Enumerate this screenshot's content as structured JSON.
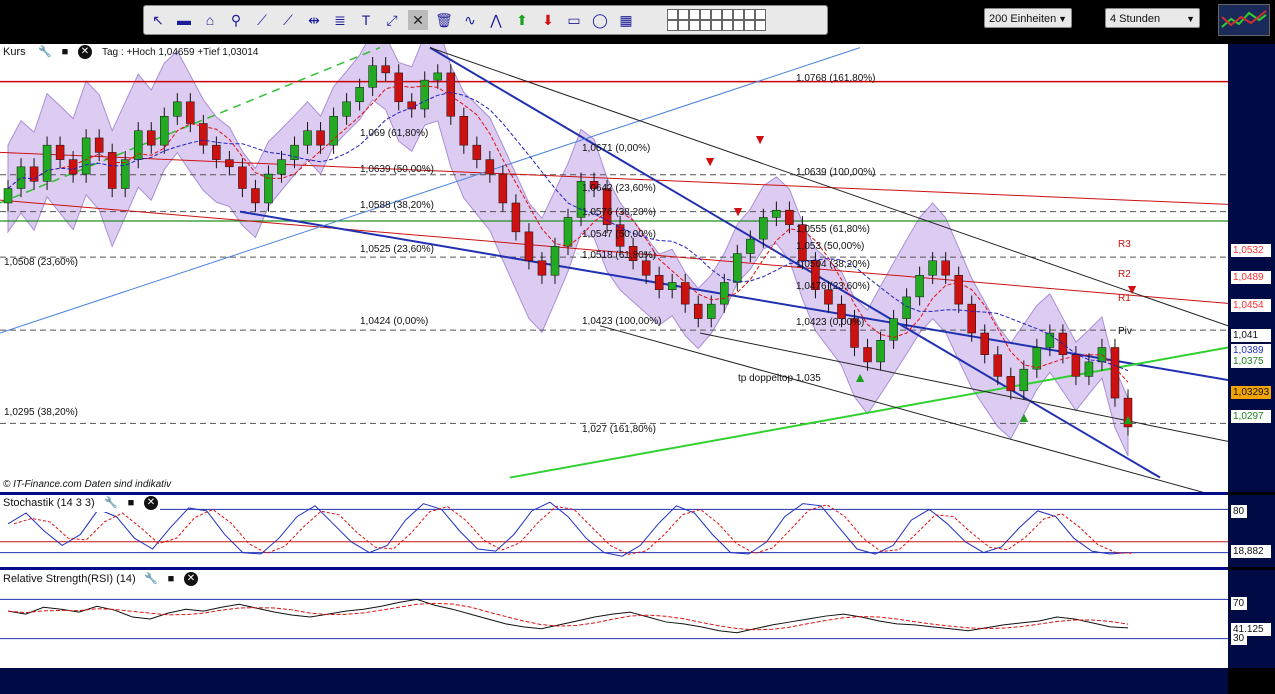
{
  "toolbar": {
    "tools": [
      "pointer-icon",
      "ruler-icon",
      "magnet-icon",
      "zoom-icon",
      "line-icon",
      "ray-icon",
      "horizontal-line-icon",
      "fibonacci-icon",
      "text-icon",
      "arrows-icon",
      "tools-icon",
      "trash-icon",
      "wave-icon",
      "fib-fan-icon",
      "arrow-up-icon",
      "arrow-down-icon",
      "rectangle-icon",
      "ellipse-icon",
      "pattern-icon"
    ],
    "swatch_colors": [
      "#ffffff",
      "#ffffff",
      "#ffffff",
      "#ffffff",
      "#ffffff",
      "#ffffff",
      "#ffffff",
      "#ffffff",
      "#ffffff",
      "#ffffff",
      "#ffffff",
      "#ffffff",
      "#ffffff",
      "#ffffff",
      "#ffffff",
      "#ffffff",
      "#ffffff",
      "#ffffff"
    ],
    "units_select": "200 Einheiten",
    "interval_select": "4 Stunden"
  },
  "main": {
    "title": "Kurs",
    "info": "Tag : +Hoch 1,04659 +Tief 1,03014",
    "footer": "© IT-Finance.com  Daten sind indikativ",
    "annotations": [
      {
        "id": "fib1",
        "text": "1,0768 (161,80%)"
      },
      {
        "id": "fib2",
        "text": "1,069 (61,80%)"
      },
      {
        "id": "fib3",
        "text": "1,0671 (0,00%)"
      },
      {
        "id": "fib4",
        "text": "1,0639 (50,00%)"
      },
      {
        "id": "fib5",
        "text": "1,0639 (100,00%)"
      },
      {
        "id": "fib6",
        "text": "1,0642 (23,60%)"
      },
      {
        "id": "fib7",
        "text": "1,0588 (38,20%)"
      },
      {
        "id": "fib8",
        "text": "1,0576 (38,20%)"
      },
      {
        "id": "fib9",
        "text": "1,0555 (61,80%)"
      },
      {
        "id": "fib10",
        "text": "1,0547 (50,00%)"
      },
      {
        "id": "fib11",
        "text": "1,053 (50,00%)"
      },
      {
        "id": "fib12",
        "text": "1,0525 (23,60%)"
      },
      {
        "id": "fib13",
        "text": "1,0518 (61,80%)"
      },
      {
        "id": "fib14",
        "text": "1,0508 (23,60%)"
      },
      {
        "id": "fib15",
        "text": "1,0504 (38,20%)"
      },
      {
        "id": "fib16",
        "text": "1,0476 (23,60%)"
      },
      {
        "id": "fib17",
        "text": "1,0424 (0,00%)"
      },
      {
        "id": "fib18",
        "text": "1,0423 (100,00%)"
      },
      {
        "id": "fib19",
        "text": "1,0423 (0,00%)"
      },
      {
        "id": "fib20",
        "text": "tp doppeltop 1,035"
      },
      {
        "id": "fib21",
        "text": "1,0295 (38,20%)"
      },
      {
        "id": "fib22",
        "text": "1,027 (161,80%)"
      },
      {
        "id": "r3",
        "text": "R3"
      },
      {
        "id": "r2",
        "text": "R2"
      },
      {
        "id": "r1",
        "text": "R1"
      },
      {
        "id": "piv",
        "text": "Piv"
      }
    ],
    "price_labels": [
      {
        "text": "1,0532",
        "color": "#ff3030",
        "bg": "#ffffff"
      },
      {
        "text": "1,0489",
        "color": "#ff3030",
        "bg": "#ffffff"
      },
      {
        "text": "1,0454",
        "color": "#ff3030",
        "bg": "#ffffff"
      },
      {
        "text": "1,041",
        "color": "#111111",
        "bg": "#ffffff"
      },
      {
        "text": "1,0389",
        "color": "#2030c0",
        "bg": "#ffffff"
      },
      {
        "text": "1,0375",
        "color": "#208020",
        "bg": "#ffffff"
      },
      {
        "text": "1,03293",
        "color": "#111111",
        "bg": "#f2a400"
      },
      {
        "text": "1,0297",
        "color": "#208020",
        "bg": "#ffffff"
      }
    ]
  },
  "stochastic": {
    "title": "Stochastik (14 3 3)",
    "level_high": "80",
    "value": "18,882"
  },
  "rsi": {
    "title": "Relative Strength(RSI) (14)",
    "level_high": "70",
    "level_low": "30",
    "value": "41,125"
  },
  "colors": {
    "background": "#000000",
    "axis_bg": "#000a44",
    "bollinger_fill": "#d8c4f0",
    "candle_up": "#22aa22",
    "candle_down": "#cc1111",
    "panel_border": "#000a8a"
  },
  "chart_data": {
    "type": "candlestick",
    "title": "",
    "last_price": 1.03293,
    "day_high": 1.04659,
    "day_low": 1.03014,
    "ylim": [
      1.02,
      1.082
    ],
    "horizontal_levels": [
      1.0768,
      1.0588,
      1.0639,
      1.0525,
      1.0424,
      1.0295
    ],
    "pivots": {
      "R3": 1.0532,
      "R2": 1.0489,
      "R1": 1.0454,
      "Piv": 1.041
    },
    "closes": [
      1.062,
      1.065,
      1.063,
      1.068,
      1.066,
      1.064,
      1.069,
      1.067,
      1.062,
      1.066,
      1.07,
      1.068,
      1.072,
      1.074,
      1.071,
      1.068,
      1.066,
      1.065,
      1.062,
      1.06,
      1.064,
      1.066,
      1.068,
      1.07,
      1.068,
      1.072,
      1.074,
      1.076,
      1.079,
      1.078,
      1.074,
      1.073,
      1.077,
      1.078,
      1.072,
      1.068,
      1.066,
      1.064,
      1.06,
      1.056,
      1.052,
      1.05,
      1.054,
      1.058,
      1.063,
      1.062,
      1.057,
      1.054,
      1.052,
      1.05,
      1.048,
      1.049,
      1.046,
      1.044,
      1.046,
      1.049,
      1.053,
      1.055,
      1.058,
      1.059,
      1.057,
      1.052,
      1.048,
      1.046,
      1.044,
      1.04,
      1.038,
      1.041,
      1.044,
      1.047,
      1.05,
      1.052,
      1.05,
      1.046,
      1.042,
      1.039,
      1.036,
      1.034,
      1.037,
      1.04,
      1.042,
      1.039,
      1.036,
      1.038,
      1.04,
      1.033,
      1.029
    ],
    "stochastic": [
      60,
      75,
      50,
      30,
      45,
      80,
      70,
      40,
      25,
      55,
      82,
      78,
      45,
      20,
      18,
      40,
      70,
      85,
      60,
      35,
      20,
      30,
      65,
      88,
      80,
      50,
      25,
      22,
      45,
      78,
      90,
      70,
      40,
      20,
      15,
      30,
      60,
      85,
      75,
      45,
      20,
      18,
      35,
      70,
      88,
      85,
      55,
      25,
      18,
      30,
      65,
      80,
      60,
      35,
      20,
      28,
      55,
      78,
      70,
      40,
      22,
      18,
      20
    ],
    "rsi": [
      58,
      55,
      62,
      60,
      57,
      63,
      59,
      52,
      50,
      56,
      60,
      58,
      62,
      65,
      61,
      57,
      54,
      52,
      55,
      58,
      60,
      63,
      67,
      70,
      64,
      60,
      55,
      50,
      45,
      42,
      40,
      44,
      48,
      52,
      55,
      57,
      52,
      47,
      45,
      42,
      38,
      36,
      40,
      44,
      47,
      50,
      53,
      55,
      52,
      48,
      45,
      44,
      42,
      40,
      38,
      41,
      44,
      46,
      48,
      52,
      50,
      46,
      42,
      41
    ]
  }
}
